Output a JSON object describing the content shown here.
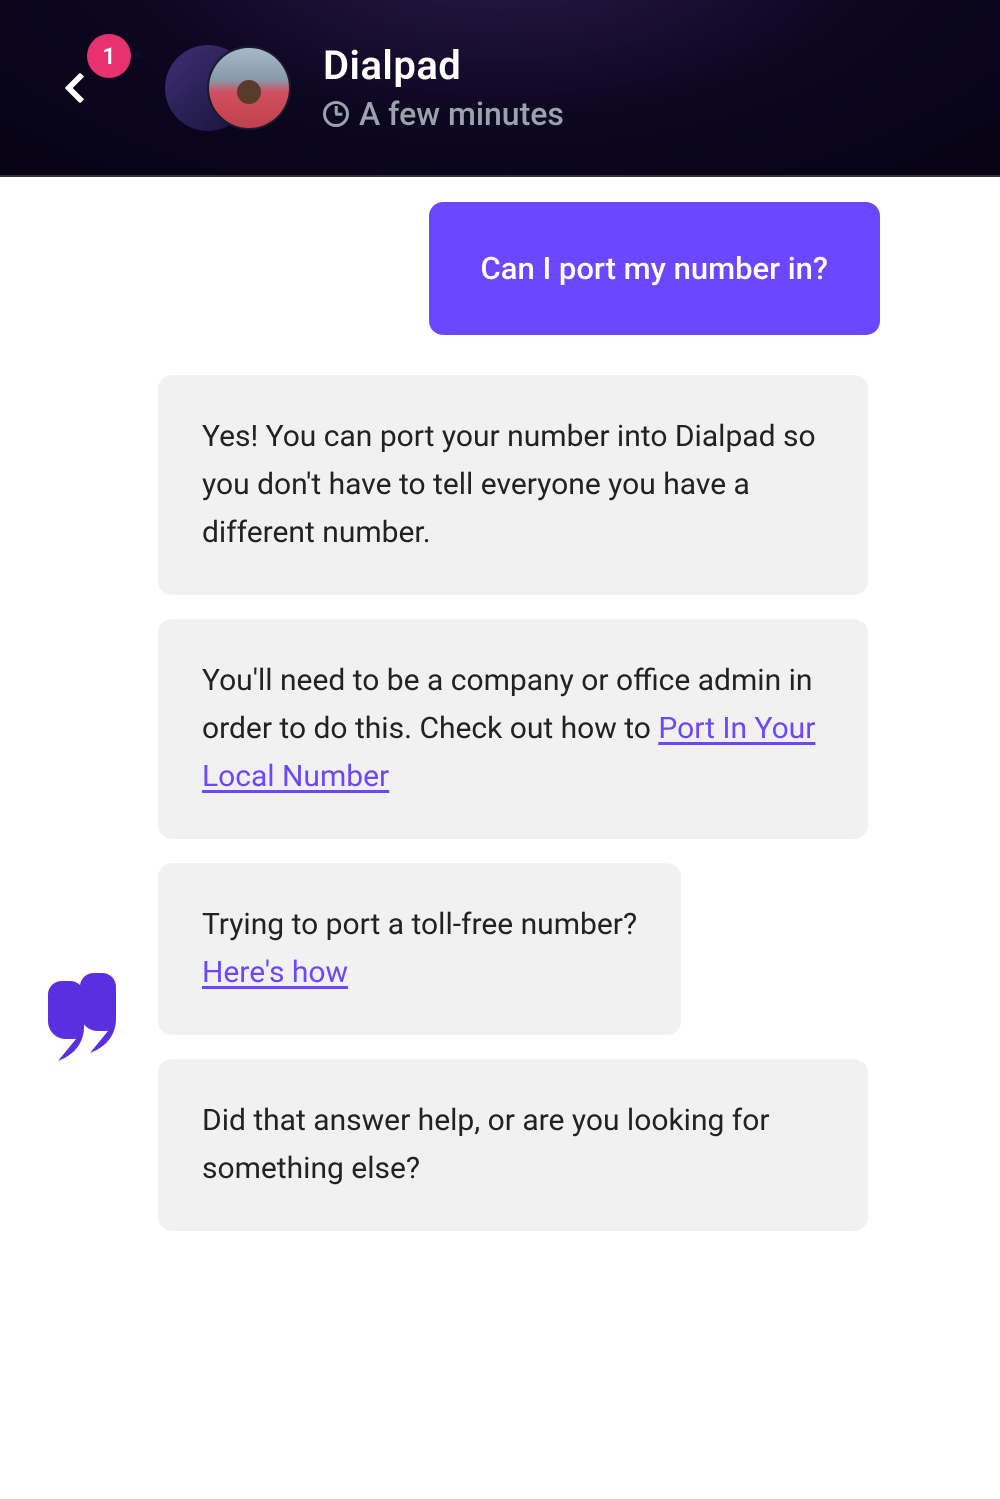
{
  "header": {
    "title": "Dialpad",
    "subtitle": "A few minutes",
    "badge_count": "1"
  },
  "chat": {
    "user_msg": "Can I port my number in?",
    "bot_msg_1": "Yes! You can port your number into Dialpad so you don't have to tell everyone you have a different number.",
    "bot_msg_2_pre": "You'll need to be a company or office admin in order to do this. Check out how to ",
    "bot_msg_2_link": "Port In Your Local Number",
    "bot_msg_3_pre": "Trying to port a toll-free number? ",
    "bot_msg_3_link": "Here's how",
    "bot_msg_4": "Did that answer help, or are you looking for something else?"
  },
  "colors": {
    "accent": "#6c47ff",
    "badge": "#e8316f",
    "bot_bubble": "#f1f1f1"
  }
}
